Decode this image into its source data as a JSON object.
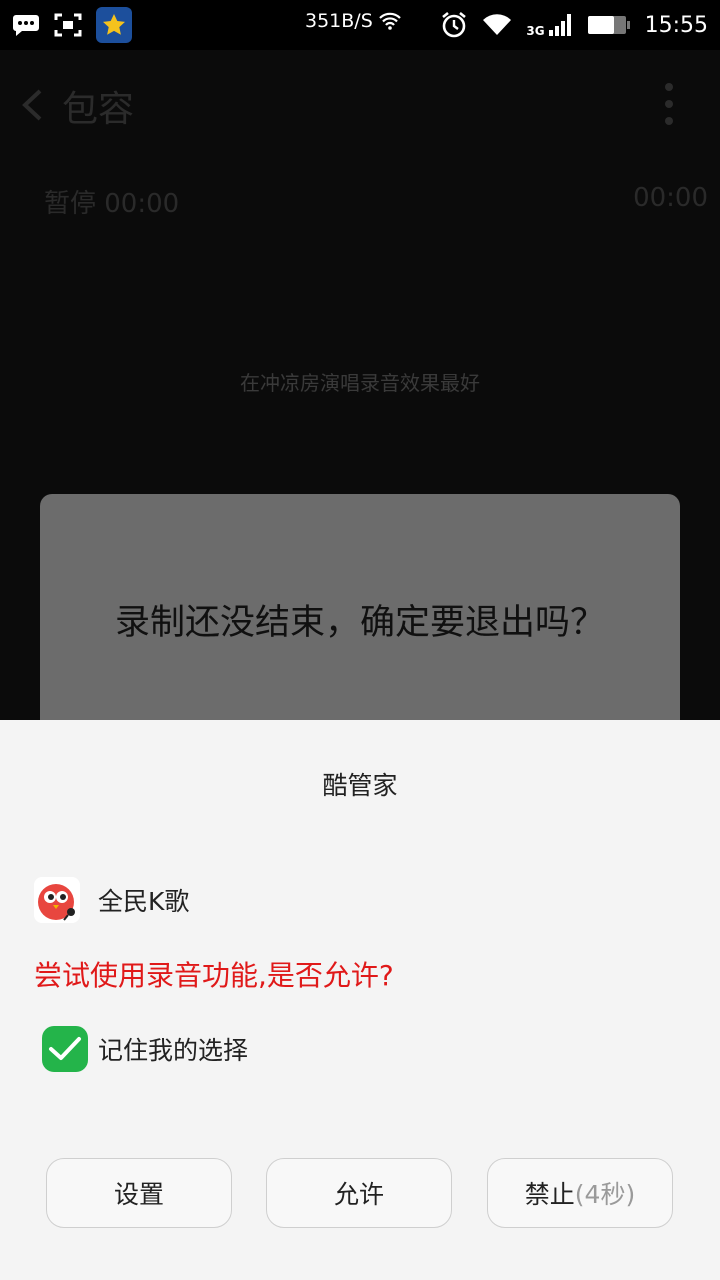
{
  "status_bar": {
    "speed": "351B/S",
    "time": "15:55",
    "network": "3G",
    "icons": [
      "chat-icon",
      "screenshot-icon",
      "star-app-icon",
      "wifi-icon",
      "alarm-icon",
      "wifi-icon",
      "signal-icon",
      "battery-icon"
    ]
  },
  "background": {
    "title": "包容",
    "paused": "暂停 00:00",
    "total": "00:00",
    "tip": "在冲凉房演唱录音效果最好"
  },
  "exit_dialog": {
    "message": "录制还没结束，确定要退出吗？"
  },
  "permission": {
    "title": "酷管家",
    "app_name": "全民K歌",
    "request": "尝试使用录音功能,是否允许?",
    "remember": "记住我的选择",
    "remember_checked": true,
    "buttons": {
      "settings": "设置",
      "allow": "允许",
      "deny": "禁止",
      "countdown": "(4秒)"
    }
  },
  "colors": {
    "request_text": "#e01919",
    "checkbox": "#24b44a",
    "sheet_bg": "#f4f4f4"
  }
}
